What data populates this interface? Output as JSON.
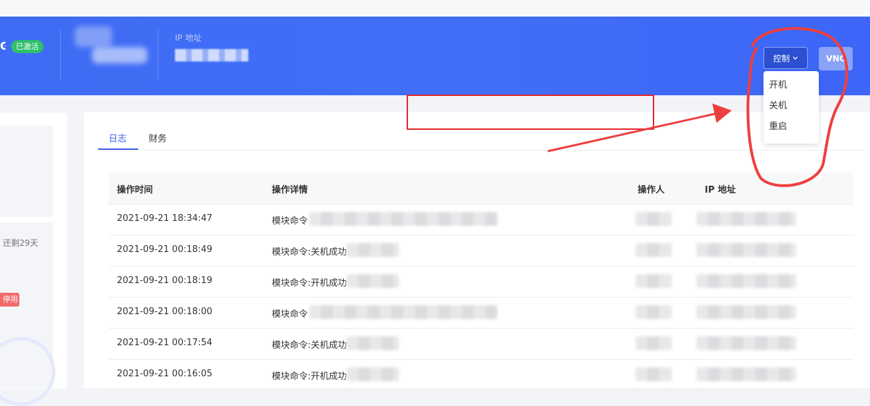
{
  "header": {
    "title_fragment": "G",
    "status_badge": "已激活",
    "ip_label": "IP 地址"
  },
  "controls": {
    "control_label": "控制",
    "vnc_label": "VNC",
    "menu": [
      "开机",
      "关机",
      "重启"
    ]
  },
  "sidebar": {
    "remaining_text": "还剩29天",
    "tag_text": "停用"
  },
  "tabs": [
    "日志",
    "财务"
  ],
  "table": {
    "headers": [
      "操作时间",
      "操作详情",
      "操作人",
      "IP 地址"
    ],
    "rows": [
      {
        "time": "2021-09-21 18:34:47",
        "detail": "模块命令"
      },
      {
        "time": "2021-09-21 00:18:49",
        "detail": "模块命令:关机成功"
      },
      {
        "time": "2021-09-21 00:18:19",
        "detail": "模块命令:开机成功"
      },
      {
        "time": "2021-09-21 00:18:00",
        "detail": "模块命令"
      },
      {
        "time": "2021-09-21 00:17:54",
        "detail": "模块命令:关机成功"
      },
      {
        "time": "2021-09-21 00:16:05",
        "detail": "模块命令:开机成功"
      }
    ]
  },
  "colors": {
    "banner": "#416ef6",
    "accent": "#3e5ff0",
    "status_green": "#2fbf6a",
    "annotation_red": "#e3262b"
  }
}
